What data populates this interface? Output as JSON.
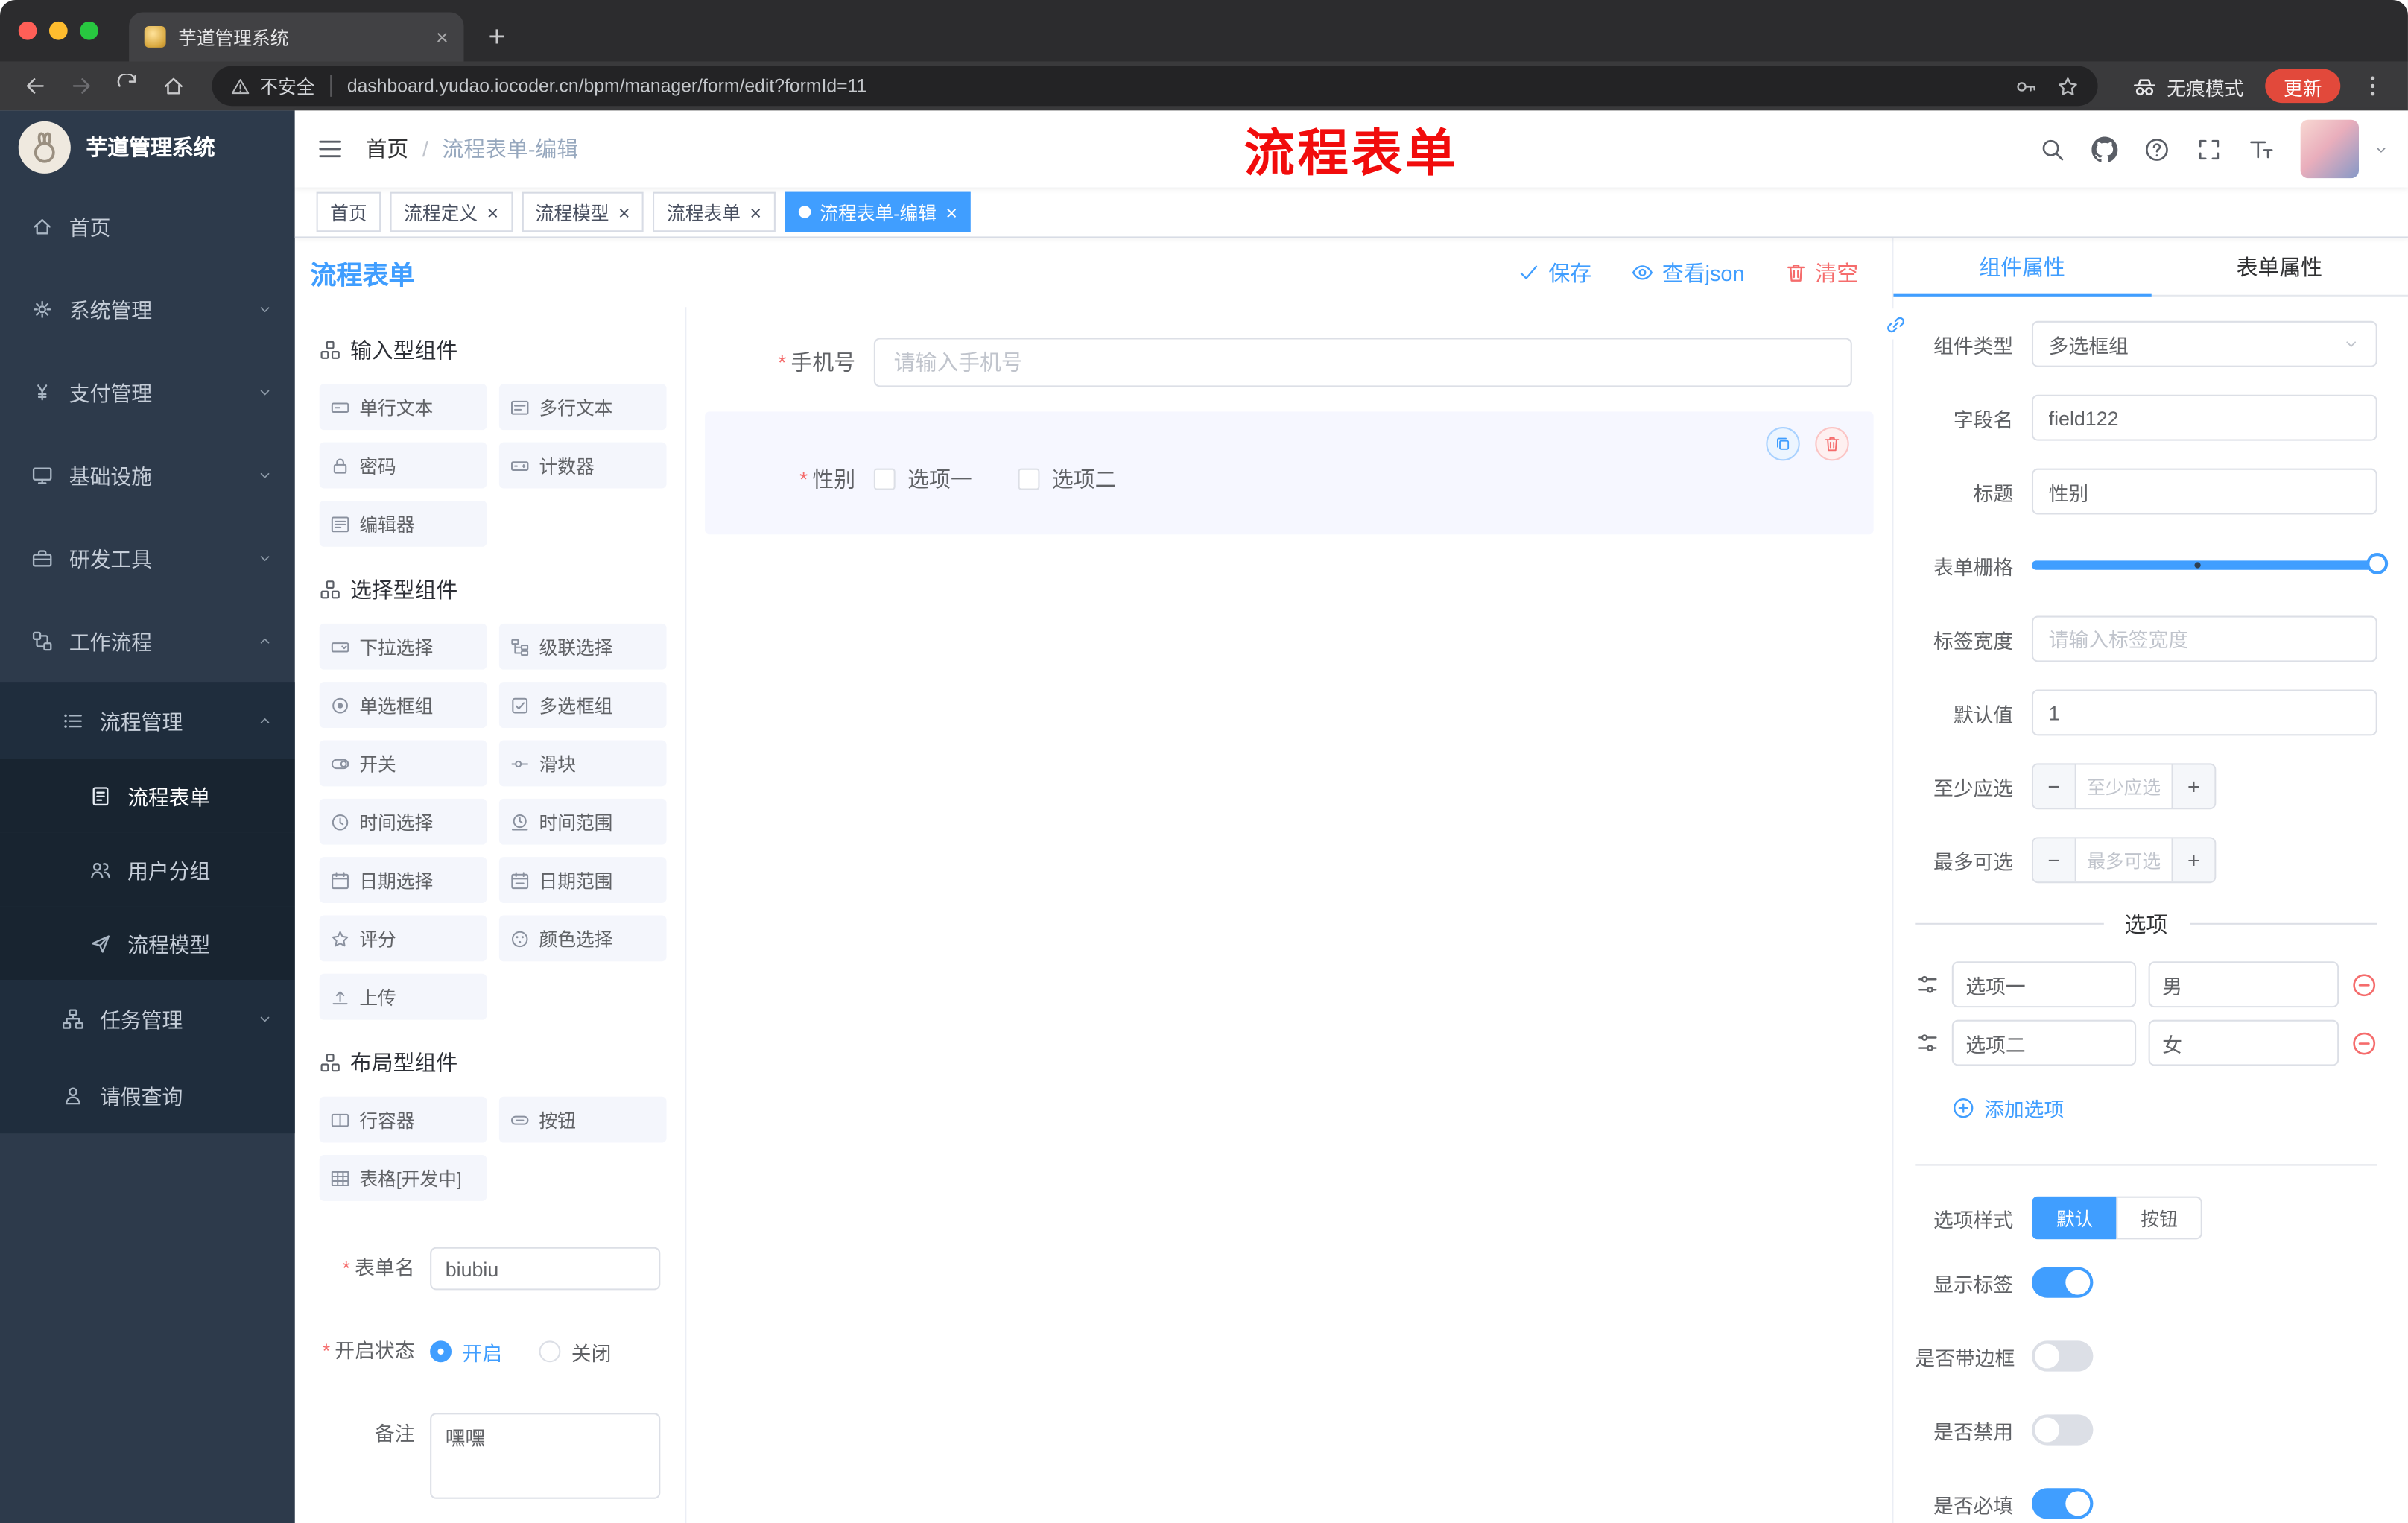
{
  "browser": {
    "tab_title": "芋道管理系统",
    "new_tab": "+",
    "address": {
      "security": "不安全",
      "url": "dashboard.yudao.iocoder.cn/bpm/manager/form/edit?formId=11"
    },
    "incognito": "无痕模式",
    "update": "更新"
  },
  "annotation": {
    "text": "流程表单",
    "color": "#f10c0c"
  },
  "sidebar": {
    "logo_title": "芋道管理系统",
    "items": [
      {
        "id": "home",
        "label": "首页",
        "icon": "home",
        "level": 1
      },
      {
        "id": "system-management",
        "label": "系统管理",
        "icon": "gear",
        "level": 1,
        "expand": "down"
      },
      {
        "id": "payment-management",
        "label": "支付管理",
        "icon": "yen",
        "level": 1,
        "expand": "down"
      },
      {
        "id": "infrastructure",
        "label": "基础设施",
        "icon": "monitor",
        "level": 1,
        "expand": "down"
      },
      {
        "id": "dev-tools",
        "label": "研发工具",
        "icon": "toolbox",
        "level": 1,
        "expand": "down"
      },
      {
        "id": "workflow",
        "label": "工作流程",
        "icon": "flow",
        "level": 1,
        "expand": "up"
      },
      {
        "id": "process-management",
        "label": "流程管理",
        "icon": "list",
        "level": 2,
        "expand": "up"
      },
      {
        "id": "process-form",
        "label": "流程表单",
        "icon": "doc",
        "level": 3,
        "active": true
      },
      {
        "id": "user-group",
        "label": "用户分组",
        "icon": "users",
        "level": 3
      },
      {
        "id": "process-model",
        "label": "流程模型",
        "icon": "send",
        "level": 3
      },
      {
        "id": "task-management",
        "label": "任务管理",
        "icon": "tree",
        "level": 2,
        "expand": "down"
      },
      {
        "id": "leave-query",
        "label": "请假查询",
        "icon": "person",
        "level": 2
      }
    ]
  },
  "navbar": {
    "breadcrumb": [
      "首页",
      "流程表单-编辑"
    ],
    "icons": [
      "search",
      "github",
      "question",
      "fullscreen",
      "fontsize"
    ]
  },
  "tags": [
    {
      "id": "home",
      "label": "首页"
    },
    {
      "id": "process-definition",
      "label": "流程定义",
      "closable": true
    },
    {
      "id": "process-model",
      "label": "流程模型",
      "closable": true
    },
    {
      "id": "process-form",
      "label": "流程表单",
      "closable": true
    },
    {
      "id": "process-form-edit",
      "label": "流程表单-编辑",
      "closable": true,
      "active": true
    }
  ],
  "designer": {
    "title": "流程表单",
    "actions": [
      {
        "id": "save",
        "label": "保存",
        "icon": "check",
        "type": "primary"
      },
      {
        "id": "view-json",
        "label": "查看json",
        "icon": "eye",
        "type": "primary"
      },
      {
        "id": "clear",
        "label": "清空",
        "icon": "trash",
        "type": "danger"
      }
    ],
    "sections": [
      {
        "title": "输入型组件",
        "items": [
          {
            "id": "single-text",
            "label": "单行文本",
            "icon": "text-field"
          },
          {
            "id": "multi-text",
            "label": "多行文本",
            "icon": "textarea"
          },
          {
            "id": "password",
            "label": "密码",
            "icon": "lock"
          },
          {
            "id": "counter",
            "label": "计数器",
            "icon": "counter"
          },
          {
            "id": "editor",
            "label": "编辑器",
            "icon": "editor"
          }
        ]
      },
      {
        "title": "选择型组件",
        "items": [
          {
            "id": "select",
            "label": "下拉选择",
            "icon": "select"
          },
          {
            "id": "cascader",
            "label": "级联选择",
            "icon": "cascade"
          },
          {
            "id": "radio-group",
            "label": "单选框组",
            "icon": "radio"
          },
          {
            "id": "checkbox-group",
            "label": "多选框组",
            "icon": "checkbox"
          },
          {
            "id": "switch",
            "label": "开关",
            "icon": "switch"
          },
          {
            "id": "slider",
            "label": "滑块",
            "icon": "slider"
          },
          {
            "id": "time-picker",
            "label": "时间选择",
            "icon": "time"
          },
          {
            "id": "time-range",
            "label": "时间范围",
            "icon": "time-range"
          },
          {
            "id": "date-picker",
            "label": "日期选择",
            "icon": "date"
          },
          {
            "id": "date-range",
            "label": "日期范围",
            "icon": "date-range"
          },
          {
            "id": "rate",
            "label": "评分",
            "icon": "star"
          },
          {
            "id": "color-picker",
            "label": "颜色选择",
            "icon": "color"
          },
          {
            "id": "upload",
            "label": "上传",
            "icon": "upload"
          }
        ]
      },
      {
        "title": "布局型组件",
        "items": [
          {
            "id": "row-container",
            "label": "行容器",
            "icon": "row"
          },
          {
            "id": "button",
            "label": "按钮",
            "icon": "button"
          },
          {
            "id": "table",
            "label": "表格[开发中]",
            "icon": "table"
          }
        ]
      }
    ],
    "meta_form": {
      "name_label": "表单名",
      "name_value": "biubiu",
      "status_label": "开启状态",
      "status_options": [
        "开启",
        "关闭"
      ],
      "status_selected": "开启",
      "remark_label": "备注",
      "remark_value": "嘿嘿"
    }
  },
  "canvas": {
    "phone": {
      "label": "手机号",
      "required": true,
      "placeholder": "请输入手机号"
    },
    "gender": {
      "label": "性别",
      "required": true,
      "options": [
        "选项一",
        "选项二"
      ],
      "selected": true
    }
  },
  "props": {
    "tabs": [
      {
        "label": "组件属性",
        "active": true
      },
      {
        "label": "表单属性"
      }
    ],
    "fields": {
      "type_label": "组件类型",
      "type_value": "多选框组",
      "field_label": "字段名",
      "field_value": "field122",
      "title_label": "标题",
      "title_value": "性别",
      "grid_label": "表单栅格",
      "labelwidth_label": "标签宽度",
      "labelwidth_placeholder": "请输入标签宽度",
      "default_label": "默认值",
      "default_value": "1",
      "min_label": "至少应选",
      "min_placeholder": "至少应选",
      "max_label": "最多可选",
      "max_placeholder": "最多可选"
    },
    "options": {
      "divider": "选项",
      "rows": [
        {
          "label": "选项一",
          "value": "男"
        },
        {
          "label": "选项二",
          "value": "女"
        }
      ],
      "add": "添加选项"
    },
    "style": {
      "label": "选项样式",
      "buttons": [
        "默认",
        "按钮"
      ],
      "selected": "默认"
    },
    "switches": [
      {
        "id": "show-label",
        "label": "显示标签",
        "on": true
      },
      {
        "id": "border",
        "label": "是否带边框",
        "on": false
      },
      {
        "id": "disabled",
        "label": "是否禁用",
        "on": false
      },
      {
        "id": "required",
        "label": "是否必填",
        "on": true
      }
    ]
  },
  "colors": {
    "accent": "#409eff",
    "danger": "#f56c6c",
    "active_tag": "#409eff",
    "annotation": "#f10c0c"
  }
}
